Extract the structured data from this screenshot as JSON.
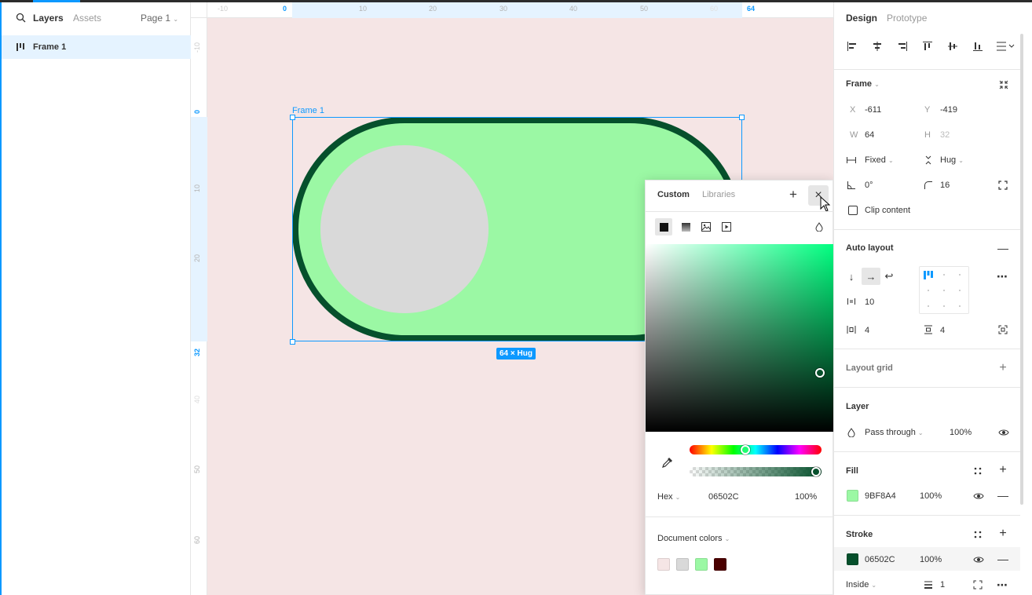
{
  "left_panel": {
    "tabs": {
      "layers": "Layers",
      "assets": "Assets",
      "page": "Page 1"
    },
    "layers": [
      {
        "label": "Frame 1"
      }
    ]
  },
  "canvas": {
    "ruler_top": {
      "ticks": [
        "-10",
        "0",
        "10",
        "20",
        "30",
        "40",
        "50",
        "60",
        "64"
      ]
    },
    "ruler_left": {
      "ticks": [
        "-10",
        "0",
        "10",
        "20",
        "32",
        "40",
        "50",
        "60"
      ]
    },
    "frame_label": "Frame 1",
    "size_badge": "64 × Hug",
    "toggle": {
      "fill": "#9BF8A4",
      "stroke": "#06502C",
      "knob": "#D9D9D9"
    },
    "background": "#F5E5E5"
  },
  "color_picker": {
    "tabs": {
      "custom": "Custom",
      "libraries": "Libraries"
    },
    "hex_mode": "Hex",
    "hex_value": "06502C",
    "opacity": "100%",
    "document_colors_label": "Document colors",
    "document_colors": [
      "#F5E5E5",
      "#D9D9D9",
      "#9BF8A4",
      "#4A0000"
    ]
  },
  "right_panel": {
    "tabs": {
      "design": "Design",
      "prototype": "Prototype"
    },
    "frame": {
      "title": "Frame",
      "x_label": "X",
      "x": "-611",
      "y_label": "Y",
      "y": "-419",
      "w_label": "W",
      "w": "64",
      "h_label": "H",
      "h": "32",
      "horizontal_resizing": "Fixed",
      "vertical_resizing": "Hug",
      "rotation": "0°",
      "radius": "16",
      "clip_content": "Clip content"
    },
    "auto_layout": {
      "title": "Auto layout",
      "gap": "10",
      "padding_h": "4",
      "padding_v": "4"
    },
    "layout_grid": {
      "title": "Layout grid"
    },
    "layer": {
      "title": "Layer",
      "blend": "Pass through",
      "opacity": "100%"
    },
    "fill": {
      "title": "Fill",
      "hex": "9BF8A4",
      "opacity": "100%",
      "color": "#9BF8A4"
    },
    "stroke": {
      "title": "Stroke",
      "hex": "06502C",
      "opacity": "100%",
      "color": "#06502C",
      "position": "Inside",
      "weight": "1"
    }
  }
}
